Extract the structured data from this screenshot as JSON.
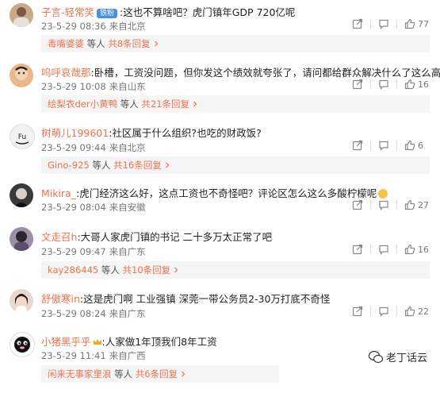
{
  "comments": [
    {
      "username": "子言-轻常笑",
      "badge": "铁粉",
      "text": ":这也不算啥吧？虎门镇年GDP 720亿呢",
      "time": "23-5-29 08:36",
      "location": "来自北京",
      "reply_user": "毒嘴婆婆",
      "reply_text": "等人",
      "reply_count": "共8条回复",
      "likes": "77"
    },
    {
      "username": "呜呼哀哉那",
      "text": ":卧槽，工资没问题，但你发这个绩效就夸张了，请问都给群众解决什么了这么高绩效",
      "time": "23-5-29 10:08",
      "location": "来自山东",
      "reply_user": "绘梨衣der小黄鸭",
      "reply_text": "等人",
      "reply_count": "共21条回复",
      "likes": "16"
    },
    {
      "username": "树萌儿199601",
      "text": ":社区属于什么组织?也吃的财政饭?",
      "time": "23-5-29 09:44",
      "location": "来自北京",
      "reply_user": "Gino-925",
      "reply_text": "等人",
      "reply_count": "共16条回复",
      "likes": "6"
    },
    {
      "username": "Mikira_",
      "text": ":虎门经济这么好，这点工资也不奇怪吧？评论区怎么这么多酸柠檬呢",
      "time": "23-5-29 08:04",
      "location": "来自安徽",
      "likes": "27"
    },
    {
      "username": "文走召h",
      "text": ":大哥人家虎门镇的书记 二十多万太正常了吧",
      "time": "23-5-29 09:47",
      "location": "来自广东",
      "reply_user": "kay286445",
      "reply_text": "等人",
      "reply_count": "共10条回复",
      "likes": "16"
    },
    {
      "username": "舒傲寒in",
      "text": ":这是虎门啊 工业强镇 深莞一带公务员2-30万打底不奇怪",
      "time": "23-5-29 08:24",
      "location": "来自广东",
      "likes": "22"
    },
    {
      "username": "小猪黑乎乎",
      "text": ":人家做1年顶我们8年工资",
      "time": "23-5-29 11:41",
      "location": "来自广西",
      "reply_user": "闲来无事家里浪",
      "reply_text": "等人",
      "reply_count": "共6条回复"
    }
  ],
  "watermark": "老丁话云",
  "icons": [
    "share-icon",
    "comment-icon",
    "like-icon",
    "reply-chevron-icon",
    "crown-icon",
    "emoji-icon"
  ],
  "colors": {
    "username": "#eb7350",
    "badge": "#4b8fe2",
    "reply_bg": "#f5f5f5"
  }
}
